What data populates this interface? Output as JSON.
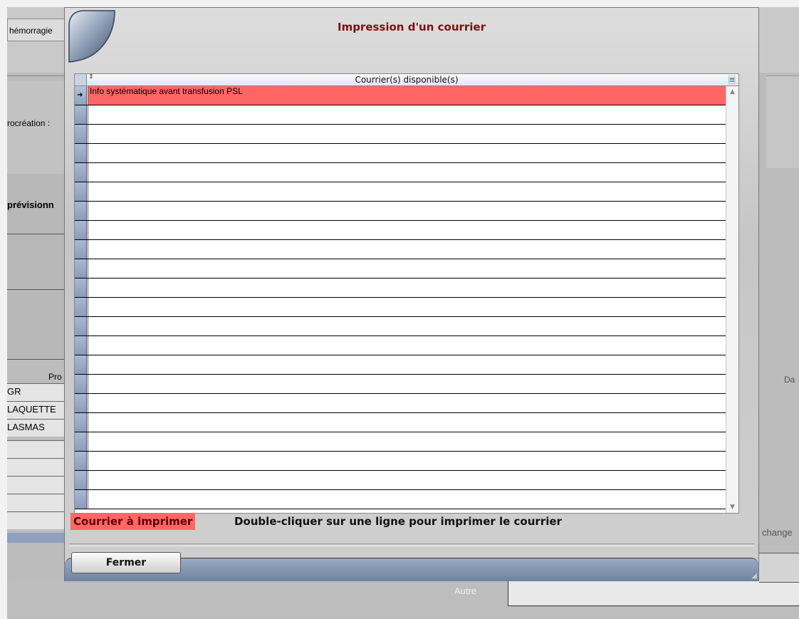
{
  "background": {
    "hemorragie_button": "hémorragie",
    "procreation_label": "rocréation :",
    "prevision_label": "prévisionn",
    "table_header_fragment": "Pro",
    "table_rows": [
      "GR",
      "LAQUETTE",
      "LASMAS"
    ],
    "right_label_da": "Da",
    "right_label_change": "change",
    "autre_label": "Autre"
  },
  "dialog": {
    "title": "Impression d'un courrier",
    "grid": {
      "column_header": "Courrier(s) disponible(s)",
      "rows": [
        "Info systématique avant transfusion PSL",
        "",
        "",
        "",
        "",
        "",
        "",
        "",
        "",
        "",
        "",
        "",
        "",
        "",
        "",
        "",
        "",
        "",
        "",
        "",
        "",
        ""
      ],
      "selected_row_index": 0
    },
    "legend_label": "Courrier à imprimer",
    "hint_text": "Double-cliquer sur une ligne pour imprimer le courrier",
    "close_button": "Fermer"
  },
  "colors": {
    "highlight": "#ff6666",
    "title": "#7d1010",
    "footer_bar": "#7e92ae"
  },
  "icons": {
    "sort": "sort-icon",
    "column_menu": "column-menu-icon",
    "row_pointer": "row-pointer-arrow-icon",
    "scroll_up": "scroll-up-arrow-icon",
    "scroll_down": "scroll-down-arrow-icon"
  }
}
